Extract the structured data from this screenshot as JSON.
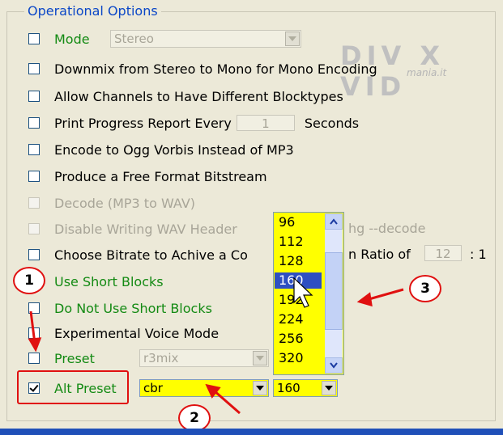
{
  "group": {
    "title": "Operational Options"
  },
  "options": {
    "mode": {
      "label": "Mode",
      "value": "Stereo"
    },
    "downmix": {
      "label": "Downmix from Stereo to Mono for Mono Encoding"
    },
    "blocktypes": {
      "label": "Allow Channels to Have Different Blocktypes"
    },
    "progress": {
      "label": "Print Progress Report Every",
      "value": "1",
      "suffix": "Seconds"
    },
    "ogg": {
      "label": "Encode to Ogg Vorbis Instead of MP3"
    },
    "free_format": {
      "label": "Produce a Free Format Bitstream"
    },
    "decode": {
      "label": "Decode (MP3 to WAV)"
    },
    "wav_header": {
      "label": "Disable Writing WAV Header",
      "tail": "hg --decode"
    },
    "bitrate": {
      "label": "Choose Bitrate to Achive a Co",
      "mid": "n Ratio of",
      "value": "12",
      "suffix": ": 1"
    },
    "short_blocks": {
      "label": "Use Short Blocks"
    },
    "no_short_blocks": {
      "label": "Do Not Use Short Blocks"
    },
    "voice": {
      "label": "Experimental Voice Mode"
    },
    "preset": {
      "label": "Preset",
      "value": "r3mix"
    },
    "alt_preset": {
      "label": "Alt Preset",
      "checked": true,
      "value": "cbr"
    },
    "bitrate_combo": {
      "value": "160"
    }
  },
  "dropdown": {
    "items": [
      "96",
      "112",
      "128",
      "160",
      "192",
      "224",
      "256",
      "320"
    ],
    "selected": "160"
  },
  "annotations": {
    "callout1": "1",
    "callout2": "2",
    "callout3": "3",
    "color": "#e01010"
  },
  "watermark": {
    "text": "DIV X VID",
    "sub": "mania.it"
  }
}
